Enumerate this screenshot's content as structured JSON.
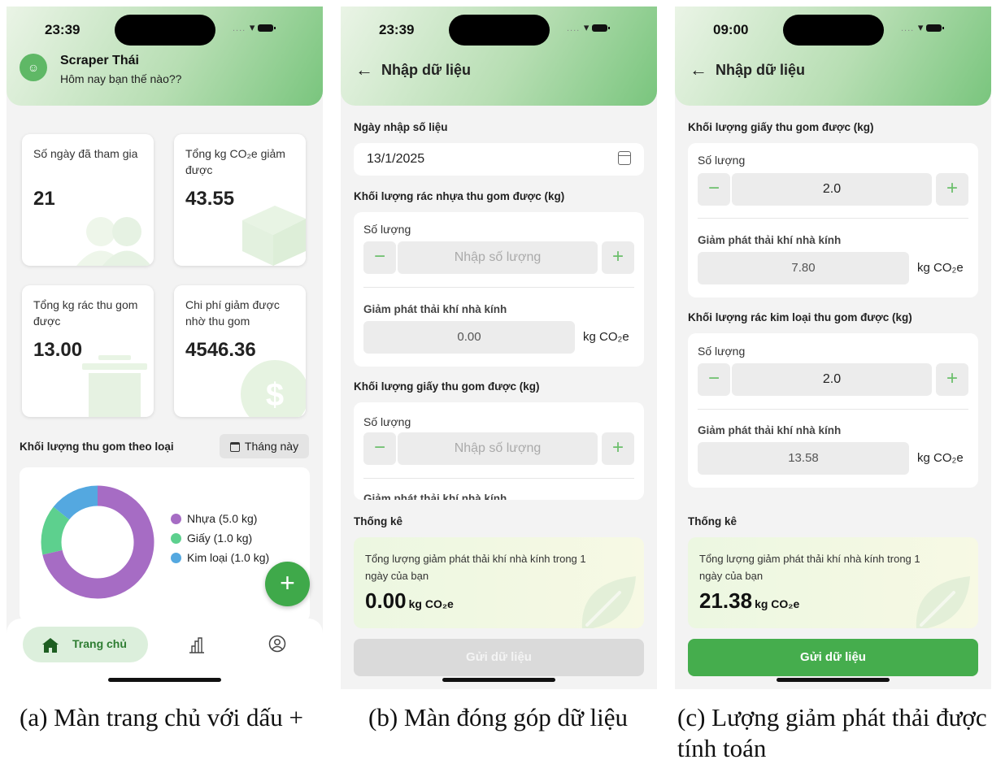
{
  "screen_a": {
    "time": "23:39",
    "user": {
      "name": "Scraper Thái",
      "greeting": "Hôm nay bạn thế nào??",
      "avatar_icon": "user-icon"
    },
    "stats": [
      {
        "label": "Số ngày đã tham gia",
        "value": "21",
        "icon": "people-icon"
      },
      {
        "label": "Tổng kg CO₂e giảm được",
        "value": "43.55",
        "icon": "box-icon"
      },
      {
        "label": "Tổng kg rác thu gom được",
        "value": "13.00",
        "icon": "trash-icon"
      },
      {
        "label": "Chi phí giảm được nhờ thu gom",
        "value": "4546.36",
        "icon": "dollar-icon"
      }
    ],
    "chart_section_title": "Khối lượng thu gom theo loại",
    "period_button": "Tháng này",
    "fab": "+",
    "nav": {
      "home_label": "Trang chủ",
      "stats_icon": "chart-icon",
      "profile_icon": "profile-icon"
    }
  },
  "chart_data": {
    "type": "pie",
    "categories": [
      "Nhựa (5.0 kg)",
      "Giấy (1.0 kg)",
      "Kim loại (1.0 kg)"
    ],
    "values": [
      5.0,
      1.0,
      1.0
    ],
    "colors": [
      "#a66cc4",
      "#5dd08e",
      "#54a8e0"
    ],
    "donut": true,
    "legend": "right"
  },
  "screen_b": {
    "time": "23:39",
    "title": "Nhập dữ liệu",
    "date_label": "Ngày nhập số liệu",
    "date_value": "13/1/2025",
    "plastic_label": "Khối lượng rác nhựa thu gom được (kg)",
    "paper_label": "Khối lượng giấy thu gom được (kg)",
    "qty_label": "Số lượng",
    "qty_placeholder": "Nhập số lượng",
    "emission_label": "Giảm phát thải khí nhà kính",
    "plastic_emission": "0.00",
    "unit": "kg CO₂e",
    "summary_title": "Thống kê",
    "summary_text": "Tổng lượng giảm phát thải khí nhà kính trong 1 ngày của bạn",
    "summary_value": "0.00",
    "summary_unit": "kg CO₂e",
    "submit": "Gửi dữ liệu"
  },
  "screen_c": {
    "time": "09:00",
    "title": "Nhập dữ liệu",
    "paper_label": "Khối lượng giấy thu gom được (kg)",
    "metal_label": "Khối lượng rác kim loại thu gom được (kg)",
    "qty_label": "Số lượng",
    "paper_qty": "2.0",
    "metal_qty": "2.0",
    "emission_label": "Giảm phát thải khí nhà kính",
    "paper_emission": "7.80",
    "metal_emission": "13.58",
    "unit": "kg CO₂e",
    "summary_title": "Thống kê",
    "summary_text": "Tổng lượng giảm phát thải khí nhà kính trong 1 ngày của bạn",
    "summary_value": "21.38",
    "summary_unit": "kg CO₂e",
    "submit": "Gửi dữ liệu"
  },
  "captions": {
    "a": "(a) Màn trang chủ với dấu +",
    "b": "(b) Màn đóng góp dữ liệu",
    "c": "(c) Lượng giảm phát thải được tính toán"
  },
  "colors": {
    "primary_green": "#45ad4d",
    "fab_green": "#3fa94a",
    "plastic": "#a66cc4",
    "paper": "#5dd08e",
    "metal": "#54a8e0"
  }
}
